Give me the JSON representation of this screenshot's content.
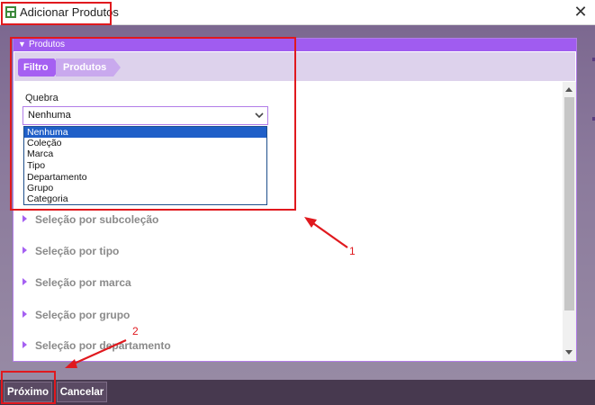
{
  "window": {
    "title": "Adicionar Produtos",
    "close_glyph": "✕",
    "icon": "app-window-icon"
  },
  "panel": {
    "title": "Produtos",
    "tabs": [
      {
        "label": "Filtro",
        "active": true
      },
      {
        "label": "Produtos",
        "active": false
      }
    ]
  },
  "quebra": {
    "label": "Quebra",
    "value": "Nenhuma",
    "options": [
      "Nenhuma",
      "Coleção",
      "Marca",
      "Tipo",
      "Departamento",
      "Grupo",
      "Categoria"
    ]
  },
  "sections": [
    "Seleção por subcoleção",
    "Seleção por tipo",
    "Seleção por marca",
    "Seleção por grupo",
    "Seleção por departamento"
  ],
  "footer": {
    "next_label": "Próximo",
    "cancel_label": "Cancelar"
  },
  "annotations": {
    "label_1": "1",
    "label_2": "2"
  },
  "colors": {
    "accent": "#a05cf0",
    "annotation": "#e0191e",
    "selection": "#1f5fc8"
  }
}
